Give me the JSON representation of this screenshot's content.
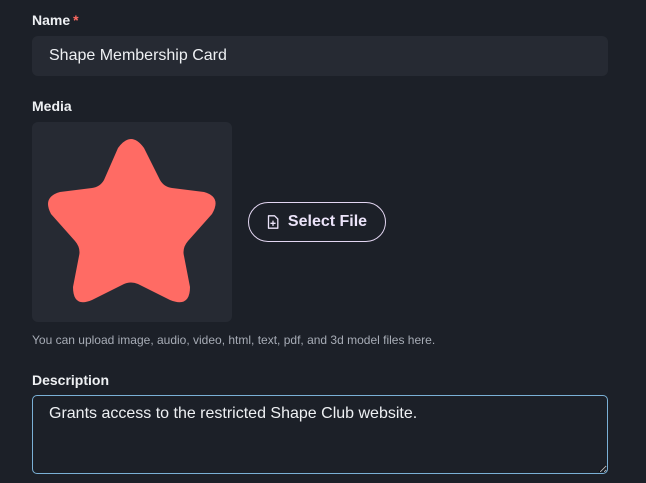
{
  "name_field": {
    "label": "Name",
    "required_marker": "*",
    "value": "Shape Membership Card"
  },
  "media_field": {
    "label": "Media",
    "preview": "star-shape",
    "preview_color": "#ff6b64",
    "select_button_label": "Select File",
    "select_button_icon": "file-add-icon",
    "hint": "You can upload image, audio, video, html, text, pdf, and 3d model files here."
  },
  "description_field": {
    "label": "Description",
    "value": "Grants access to the restricted Shape Club website."
  }
}
